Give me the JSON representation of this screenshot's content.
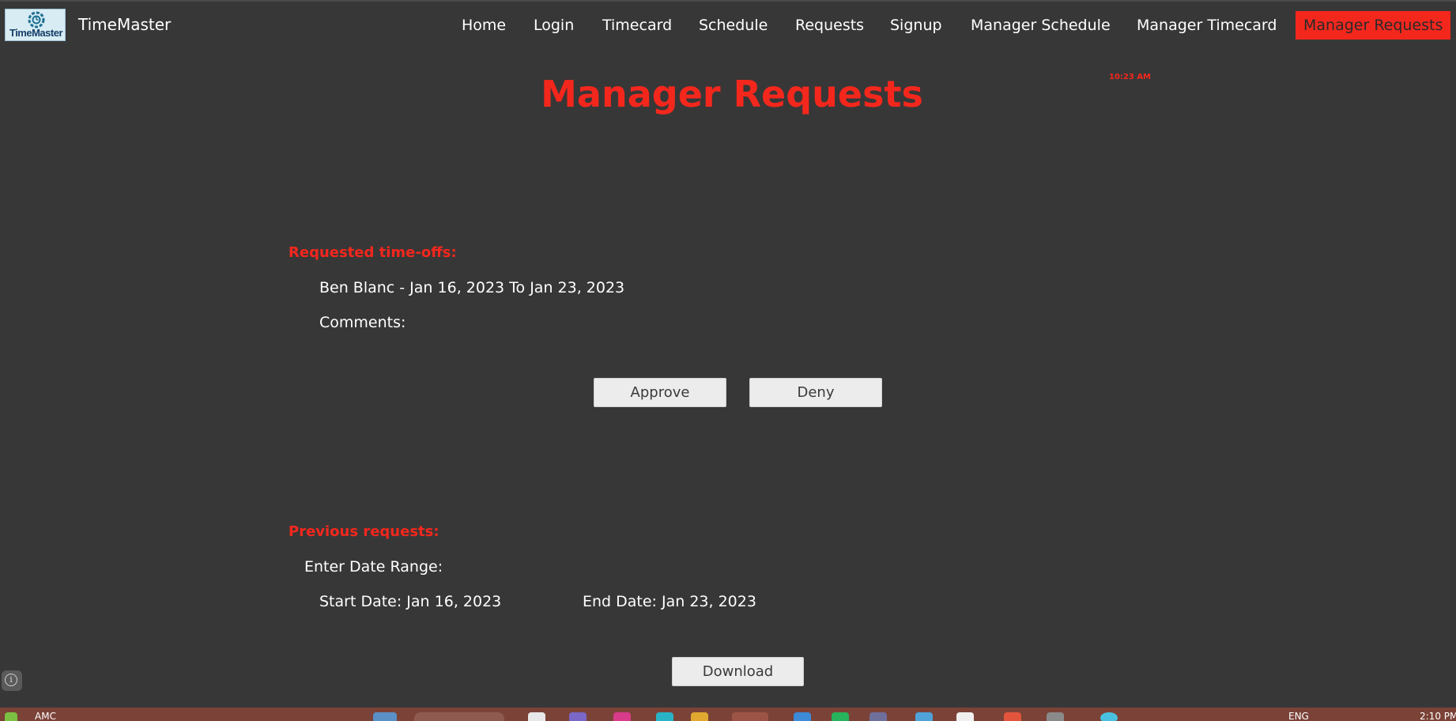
{
  "brand": {
    "logo_text": "TimeMaster",
    "name": "TimeMaster"
  },
  "nav": {
    "items": [
      {
        "label": "Home"
      },
      {
        "label": "Login"
      },
      {
        "label": "Timecard"
      },
      {
        "label": "Schedule"
      },
      {
        "label": "Requests"
      },
      {
        "label": "Signup"
      },
      {
        "label": "Manager Schedule"
      },
      {
        "label": "Manager Timecard"
      },
      {
        "label": "Manager Requests",
        "active": true
      }
    ]
  },
  "clock": "10:23 AM",
  "page_title": "Manager Requests",
  "requested": {
    "heading": "Requested time-offs:",
    "entry": "Ben Blanc - Jan 16, 2023 To Jan 23, 2023",
    "comments_label": "Comments:",
    "approve_label": "Approve",
    "deny_label": "Deny"
  },
  "previous": {
    "heading": "Previous requests:",
    "date_range_label": "Enter Date Range:",
    "start_date": "Start Date: Jan 16, 2023",
    "end_date": "End Date: Jan 23, 2023",
    "download_label": "Download"
  },
  "taskbar": {
    "left_text": "AMC",
    "lang": "ENG",
    "time": "2:10 PM"
  },
  "colors": {
    "background": "#383737",
    "accent": "#f4271d",
    "button": "#ececec",
    "taskbar": "#7b4237"
  },
  "icons": [
    "timemaster-logo-icon",
    "info-icon"
  ]
}
